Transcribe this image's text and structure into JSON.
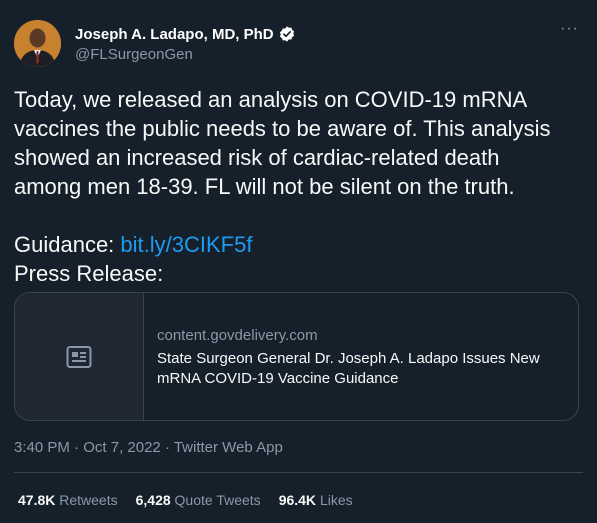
{
  "author": {
    "display_name": "Joseph A. Ladapo, MD, PhD",
    "handle": "@FLSurgeonGen",
    "verified": true
  },
  "tweet": {
    "text_lines": [
      "Today, we released an analysis on COVID-19 mRNA",
      "vaccines the public needs to be aware of. This analysis",
      "showed an increased risk of cardiac-related death",
      "among men 18-39. FL will not be silent on the truth."
    ],
    "guidance_label": "Guidance: ",
    "guidance_link": "bit.ly/3CIKF5f",
    "press_release_label": "Press Release:"
  },
  "card": {
    "domain": "content.govdelivery.com",
    "title": "State Surgeon General Dr. Joseph A. Ladapo Issues New mRNA COVID-19 Vaccine Guidance",
    "icon": "article-icon"
  },
  "meta": {
    "time": "3:40 PM",
    "date": "Oct 7, 2022",
    "separator": " · ",
    "app": "Twitter Web App"
  },
  "stats": {
    "retweets_count": "47.8K",
    "retweets_label": "Retweets",
    "quote_count": "6,428",
    "quote_label": "Quote Tweets",
    "likes_count": "96.4K",
    "likes_label": "Likes"
  },
  "menu": {
    "more_glyph": "···"
  },
  "colors": {
    "background": "#15202b",
    "link": "#1d9bf0",
    "secondary_text": "#8b98a5",
    "border": "#38444d",
    "verified_badge": "#ffffff"
  }
}
